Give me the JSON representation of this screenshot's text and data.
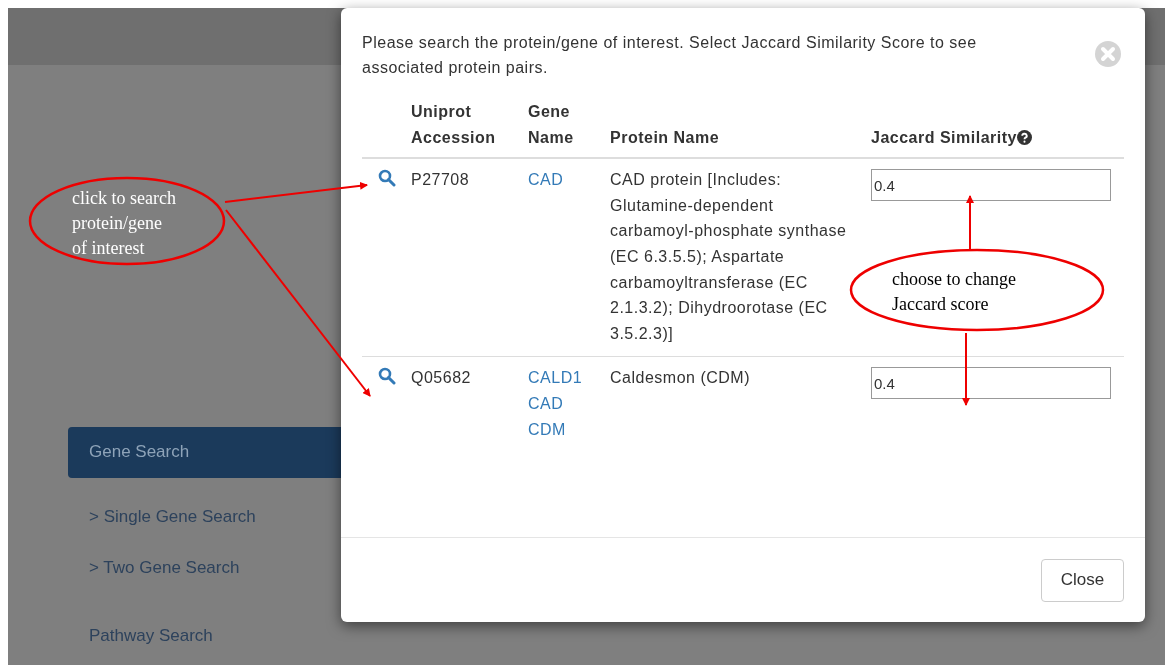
{
  "nav": [
    {
      "label": "Gene Search",
      "selected": true
    },
    {
      "label": "> Single Gene Search",
      "selected": false
    },
    {
      "label": "> Two Gene Search",
      "selected": false
    },
    {
      "label": "Pathway Search",
      "selected": false
    }
  ],
  "modal": {
    "message": "Please search the protein/gene of interest. Select Jaccard Similarity Score to see associated protein pairs.",
    "columns": [
      {
        "label": "Uniprot Accession"
      },
      {
        "label": "Gene Name"
      },
      {
        "label": "Protein Name"
      },
      {
        "label": "Jaccard Similarity",
        "help": true
      }
    ],
    "rows": [
      {
        "accession": "P27708",
        "genes": [
          "CAD"
        ],
        "protein": "CAD protein [Includes: Glutamine-dependent carbamoyl-phosphate synthase (EC 6.3.5.5); Aspartate carbamoyltransferase (EC 2.1.3.2); Dihydroorotase (EC 3.5.2.3)]",
        "jaccard": "0.4"
      },
      {
        "accession": "Q05682",
        "genes": [
          "CALD1",
          "CAD",
          "CDM"
        ],
        "protein": "Caldesmon (CDM)",
        "jaccard": "0.4"
      }
    ],
    "close_label": "Close"
  },
  "annotations": [
    {
      "text": "click to search\nprotein/gene\nof interest"
    },
    {
      "text": "choose to change\nJaccard score"
    }
  ]
}
